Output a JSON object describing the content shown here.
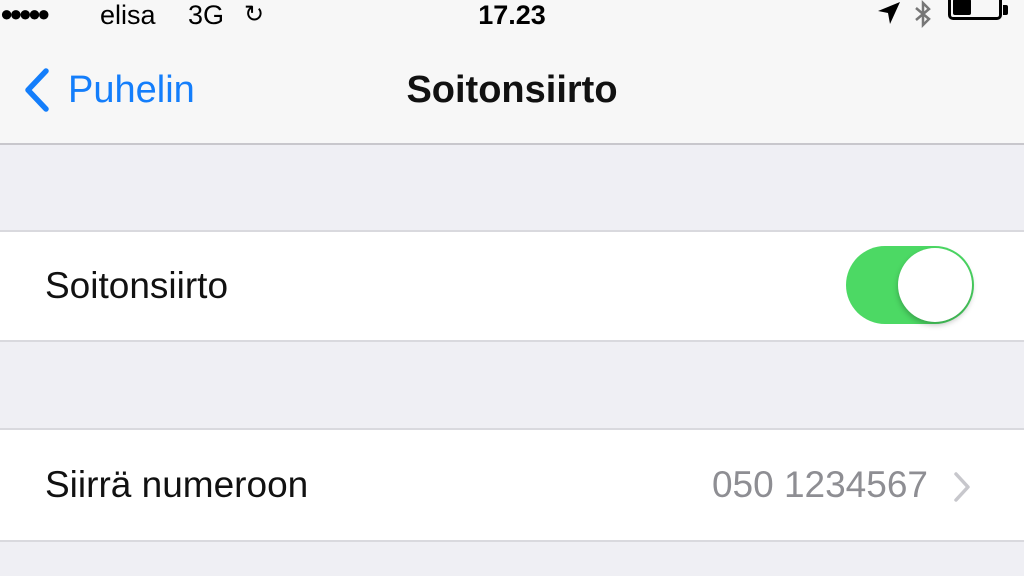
{
  "status_bar": {
    "signal": "●●●●●",
    "carrier": "elisa",
    "network": "3G",
    "sync_icon": "↻",
    "time": "17.23",
    "icons": [
      "location-icon",
      "bluetooth-icon",
      "battery-icon"
    ]
  },
  "nav": {
    "back_label": "Puhelin",
    "title": "Soitonsiirto"
  },
  "settings": {
    "forwarding": {
      "label": "Soitonsiirto",
      "enabled": true
    },
    "forward_to": {
      "label": "Siirrä numeroon",
      "value": "050 1234567"
    }
  },
  "colors": {
    "accent": "#147efb",
    "toggle_on": "#4cd964",
    "background": "#efeff4",
    "secondary_text": "#8e8e93"
  }
}
